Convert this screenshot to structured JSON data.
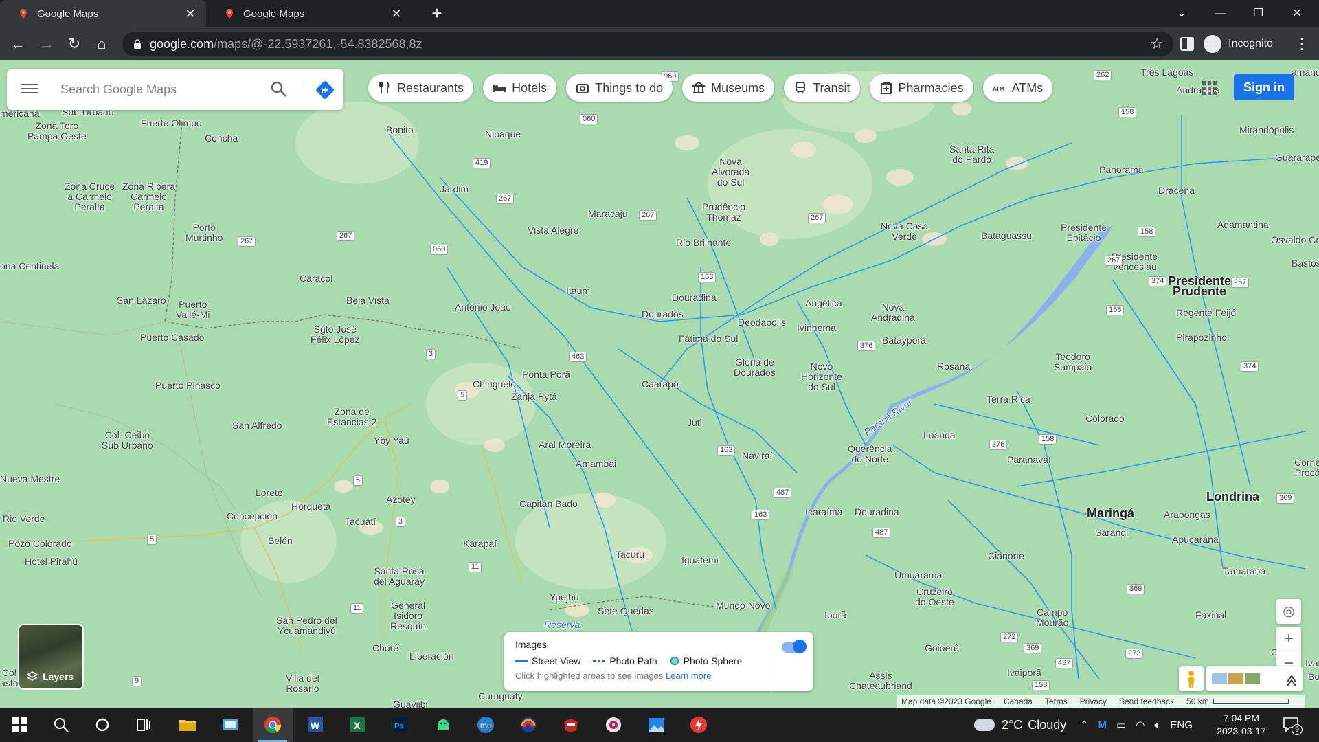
{
  "browser": {
    "tabs": [
      {
        "title": "Google Maps",
        "active": true
      },
      {
        "title": "Google Maps",
        "active": false
      }
    ],
    "new_tab_label": "+",
    "url_host": "google.com",
    "url_path": "/maps/@-22.5937261,-54.8382568,8z",
    "profile_label": "Incognito"
  },
  "maps": {
    "search_placeholder": "Search Google Maps",
    "chips": [
      {
        "label": "Restaurants",
        "icon": "restaurant-icon"
      },
      {
        "label": "Hotels",
        "icon": "hotel-icon"
      },
      {
        "label": "Things to do",
        "icon": "camera-icon"
      },
      {
        "label": "Museums",
        "icon": "museum-icon"
      },
      {
        "label": "Transit",
        "icon": "transit-icon"
      },
      {
        "label": "Pharmacies",
        "icon": "pharmacy-icon"
      },
      {
        "label": "ATMs",
        "icon": "atm-icon"
      }
    ],
    "sign_in_label": "Sign in",
    "layers_label": "Layers",
    "images_panel": {
      "title": "Images",
      "street_view": "Street View",
      "photo_path": "Photo Path",
      "photo_sphere": "Photo Sphere",
      "hint": "Click highlighted areas to see images",
      "learn_more": "Learn more"
    },
    "footer": {
      "map_data": "Map data ©2023 Google",
      "country": "Canada",
      "terms": "Terms",
      "privacy": "Privacy",
      "feedback": "Send feedback",
      "scale": "50 km"
    },
    "places": [
      "Sub-Urbano",
      "Zona Toro\nPampa Oeste",
      "Fuerte Olimpo",
      "Bonito",
      "Nioaque",
      "Concha",
      "Jardim",
      "Zona Cruce\na Carmelo\nPeralta",
      "Zona Ribera\nCarmelo\nPeralta",
      "Porto\nMurtinho",
      "ona Centinela",
      "Caracol",
      "Bela Vista",
      "San Lázaro",
      "Puerto\nVallé-Mi",
      "Sgto José\nFélix López",
      "Puerto Casado",
      "Antônio João",
      "Itaum",
      "Maracaju",
      "Vista Alegre",
      "Nova\nAlvorada\ndo Sul",
      "Prudêncio\nThomaz",
      "Rio Brilhante",
      "Douradina",
      "Dourados",
      "Fátima do Sul",
      "Deodápolis",
      "Angélica",
      "Ivinhema",
      "Nova\nAndradina",
      "Batayporã",
      "Santa Rita\ndo Pardo",
      "Nova Casa\nVerde",
      "Bataguassu",
      "Presidente\nEpitácio",
      "Panorama",
      "Dracena",
      "Três Lagoas",
      "Andradina",
      "Mirandópolis",
      "Guararapes",
      "Adamantina",
      "Osvaldo Cruz",
      "Presidente\nVenceslau",
      "Presidente\nPrudente",
      "Regente Feijó",
      "Bastos",
      "Pirapozinho",
      "Teodoro\nSampaio",
      "Rosana",
      "Terra Rica",
      "Glória de\nDourados",
      "Novo\nHorizonte\ndo Sul",
      "Ponta Porã",
      "Zanja Pytá",
      "Chiriguelo",
      "Caarapó",
      "Juti",
      "Naviraí",
      "Paraná River",
      "Loanda",
      "Querência\ndo Norte",
      "Paranavaí",
      "Colorado",
      "Puerto Pinasco",
      "Zona de\nEstancias 2",
      "San Alfredo",
      "Col. Ceibo\nSub Urbano",
      "Yby Yaú",
      "Aral Moreira",
      "Amambai",
      "Nueva Mestre",
      "Loreto",
      "Horqueta",
      "Azotey",
      "Rio Verde",
      "Concepción",
      "Tacuatí",
      "Capitán Bado",
      "Belén",
      "Pozo Colorado",
      "Hotel Pirahú",
      "Karapaí",
      "Santa Rosa\ndel Aguaray",
      "General\nIsidoro\nResquín",
      "Tacuru",
      "Iguatemi",
      "Icaraíma",
      "Douradina",
      "Maringá",
      "Sarandi",
      "Londrina",
      "Arapongas",
      "Apucarana",
      "Cianorte",
      "Umuarama",
      "Cruzeiro\ndo Oeste",
      "Ypejhú",
      "Sete Quedas",
      "Mundo Novo",
      "Reserva",
      "Iporã",
      "Campo\nMourão",
      "Tamarana",
      "Faxinal",
      "Ortigu",
      "Goioerê",
      "San Pedro del\nYcuamandiyú",
      "Choré",
      "Liberación",
      "Villa del\nRosario",
      "Curuguaty",
      "Guaviibi",
      "Assis\nChateaubriand",
      "Ivaiporã",
      "Corne\nProcó",
      "amandi",
      "Col\nasto",
      "Bor",
      "Ivaipe",
      "mericana"
    ],
    "routes": [
      "060",
      "419",
      "267",
      "060",
      "267",
      "267",
      "267",
      "163",
      "267",
      "262",
      "158",
      "158",
      "267",
      "374",
      "267",
      "158",
      "374",
      "376",
      "3",
      "5",
      "463",
      "163",
      "487",
      "163",
      "5",
      "3",
      "11",
      "11",
      "9",
      "5",
      "376",
      "158",
      "487",
      "272",
      "369",
      "487",
      "158",
      "272",
      "369",
      "369",
      "060"
    ]
  },
  "taskbar": {
    "weather_temp": "2°C",
    "weather_desc": "Cloudy",
    "language": "ENG",
    "time": "7:04 PM",
    "date": "2023-03-17",
    "notification_count": "9"
  }
}
